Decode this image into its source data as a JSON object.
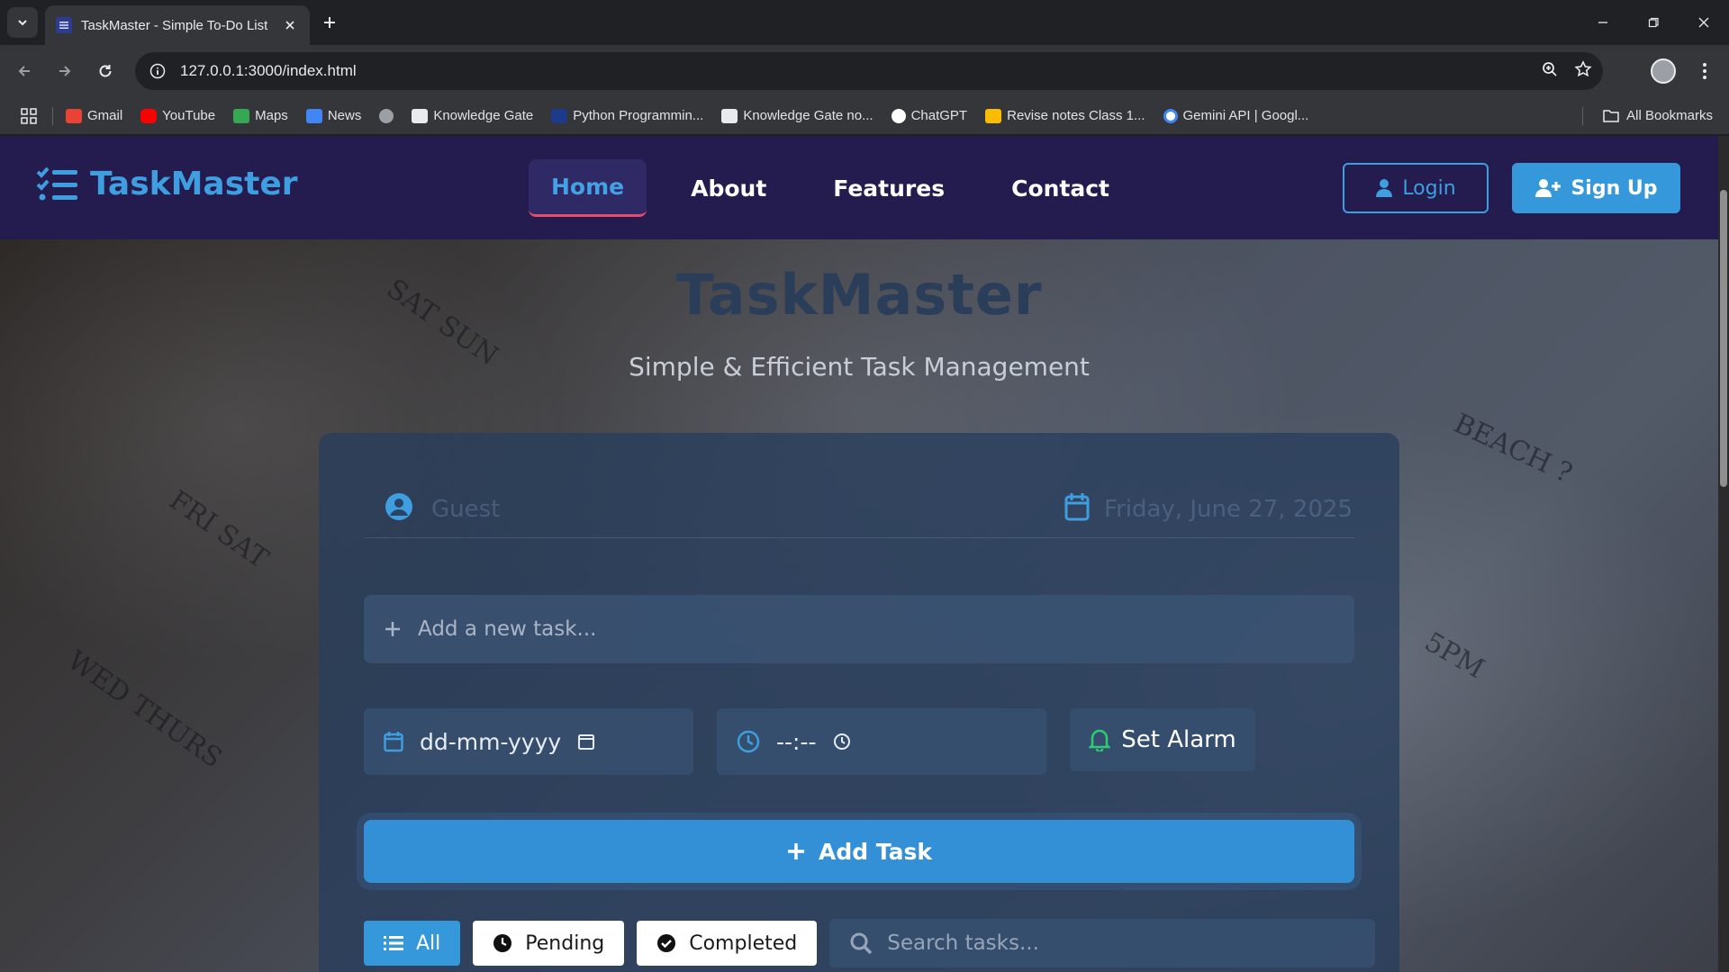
{
  "browser": {
    "tab_title": "TaskMaster - Simple To-Do List",
    "url": "127.0.0.1:3000/index.html",
    "bookmarks": [
      {
        "label": "Gmail",
        "color": "#ea4335"
      },
      {
        "label": "YouTube",
        "color": "#ff0000"
      },
      {
        "label": "Maps",
        "color": "#34a853"
      },
      {
        "label": "News",
        "color": "#4285f4"
      },
      {
        "label": "",
        "color": "#9aa0a6"
      },
      {
        "label": "Knowledge Gate",
        "color": "#e8eaed"
      },
      {
        "label": "Python Programmin...",
        "color": "#1e3a8a"
      },
      {
        "label": "Knowledge Gate no...",
        "color": "#e8eaed"
      },
      {
        "label": "ChatGPT",
        "color": "#ffffff"
      },
      {
        "label": "Revise notes Class 1...",
        "color": "#fbbc04"
      },
      {
        "label": "Gemini API | Googl...",
        "color": "#4285f4"
      }
    ],
    "all_bookmarks": "All Bookmarks"
  },
  "site": {
    "logo": "TaskMaster",
    "nav": {
      "home": "Home",
      "about": "About",
      "features": "Features",
      "contact": "Contact"
    },
    "login": "Login",
    "signup": "Sign Up",
    "accent": "#3498db",
    "header_bg": "#241b4f"
  },
  "hero": {
    "title": "TaskMaster",
    "subtitle": "Simple & Efficient Task Management"
  },
  "card": {
    "user_name": "Guest",
    "date_text": "Friday, June 27, 2025",
    "task_placeholder": "Add a new task...",
    "date_field": "dd-mm-yyyy",
    "time_field": "--:--",
    "set_alarm": "Set Alarm",
    "add_task": "Add Task",
    "filters": {
      "all": "All",
      "pending": "Pending",
      "completed": "Completed"
    },
    "search_placeholder": "Search tasks..."
  }
}
